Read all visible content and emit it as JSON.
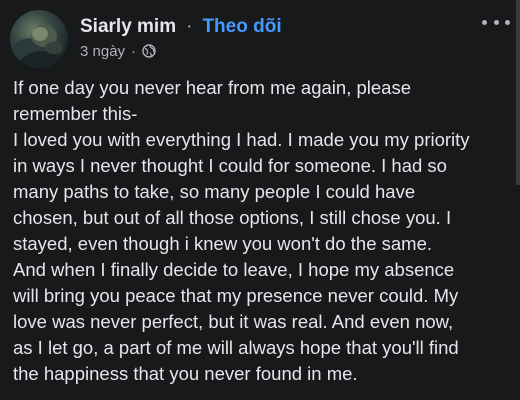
{
  "post": {
    "author": "Siarly mim",
    "separator": "·",
    "follow_label": "Theo dõi",
    "timestamp": "3 ngày",
    "meta_separator": "·",
    "privacy_icon": "globe-icon",
    "more_icon": "more-options-icon",
    "body_lines": [
      "If one day you never hear from me again, please",
      "remember this-",
      "I loved you with everything I had. I made you my priority",
      "in ways I never thought I could for someone. I had so",
      "many paths to take, so many people I could have",
      "chosen, but out of all those options, I still chose you. I",
      "stayed, even though i knew you won't do the same.",
      "And when I finally decide to leave, I hope my absence",
      "will bring you peace that my presence never could. My",
      "love was never perfect, but it was real. And even now,",
      "as I let go, a part of me will always hope that you'll find",
      "the happiness that you never found in me."
    ]
  },
  "colors": {
    "background": "#18191a",
    "text_primary": "#e4e6eb",
    "text_secondary": "#b0b3b8",
    "link_blue": "#4599ff"
  }
}
